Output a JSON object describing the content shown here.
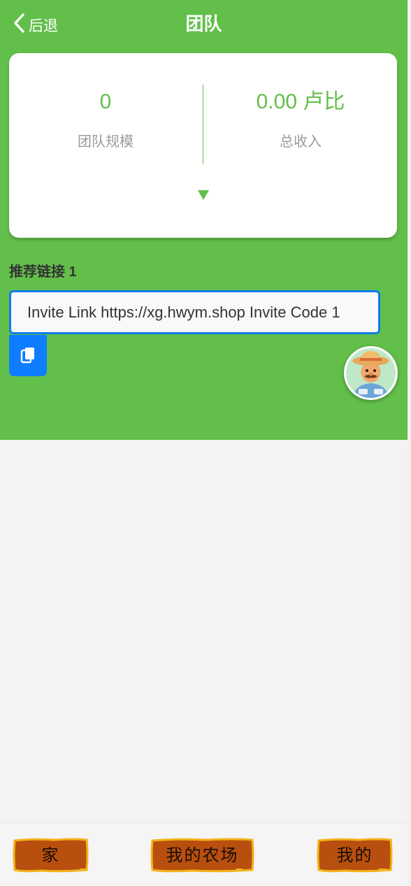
{
  "header": {
    "back_label": "后退",
    "title": "团队"
  },
  "stats": {
    "team_size_value": "0",
    "team_size_label": "团队规模",
    "total_income_value": "0.00 卢比",
    "total_income_label": "总收入"
  },
  "referral": {
    "section_title": "推荐链接 1",
    "link_value": "Invite Link https://xg.hwym.shop Invite Code 1"
  },
  "bottom_nav": {
    "home_label": "家",
    "my_farm_label": "我的农场",
    "mine_label": "我的"
  },
  "colors": {
    "primary_green": "#62bf4a",
    "input_border_blue": "#0f7de8",
    "copy_button_blue": "#0f7dff",
    "nav_wood": "#b94f0e"
  },
  "icons": {
    "back": "chevron-left-icon",
    "expand": "triangle-down-icon",
    "copy": "copy-icon",
    "avatar": "farmer-avatar"
  }
}
